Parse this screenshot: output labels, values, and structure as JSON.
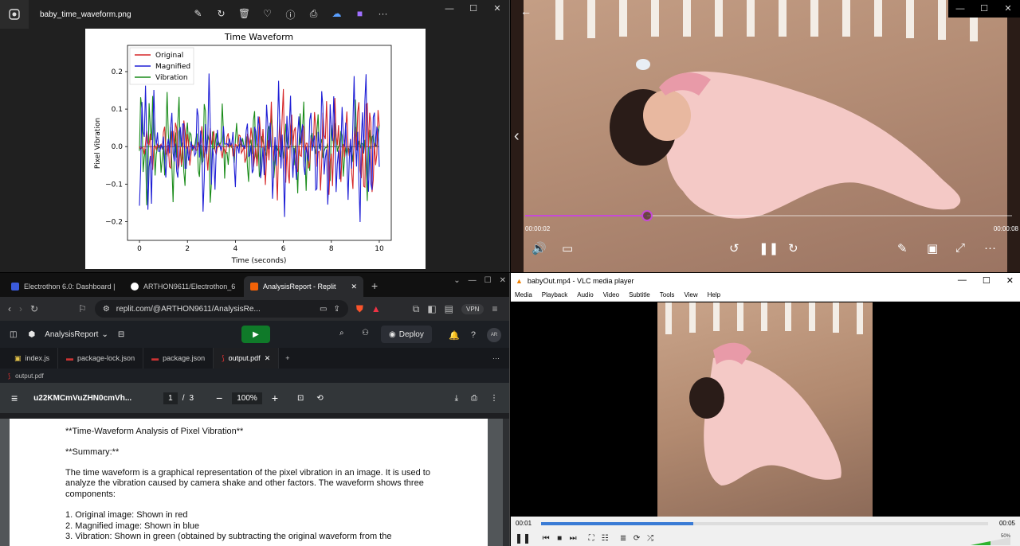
{
  "photos": {
    "filename": "baby_time_waveform.png",
    "toolbar_icons": [
      "edit-icon",
      "rotate-icon",
      "delete-icon",
      "heart-icon",
      "info-icon",
      "print-icon",
      "cloud-off-icon",
      "clipchamp-icon",
      "more-icon"
    ]
  },
  "chart_data": {
    "type": "line",
    "title": "Time Waveform",
    "xlabel": "Time (seconds)",
    "ylabel": "Pixel Vibration",
    "xlim": [
      -0.5,
      10.5
    ],
    "ylim": [
      -0.25,
      0.27
    ],
    "xticks": [
      0,
      2,
      4,
      6,
      8,
      10
    ],
    "yticks": [
      -0.2,
      -0.1,
      0.0,
      0.1,
      0.2
    ],
    "ytick_labels": [
      "−0.2",
      "−0.1",
      "0.0",
      "0.1",
      "0.2"
    ],
    "legend": "top-left",
    "series": [
      {
        "name": "Original",
        "color": "#d62728",
        "x": [
          0,
          0.5,
          1,
          1.5,
          2,
          2.5,
          3,
          3.5,
          4,
          4.5,
          5,
          5.5,
          6,
          6.5,
          7,
          7.5,
          8,
          8.5,
          9,
          9.5,
          10
        ],
        "y": [
          0.0,
          -0.08,
          0.06,
          0.1,
          0.08,
          -0.05,
          -0.08,
          0.05,
          0.03,
          0.06,
          0.09,
          0.12,
          0.18,
          0.1,
          0.06,
          0.13,
          0.17,
          0.08,
          0.14,
          0.2,
          0.1
        ]
      },
      {
        "name": "Magnified",
        "color": "#1f1fd6",
        "x": [
          0,
          0.5,
          1,
          1.5,
          2,
          2.5,
          3,
          3.5,
          4,
          4.5,
          5,
          5.5,
          6,
          6.5,
          7,
          7.5,
          8,
          8.5,
          9,
          9.5,
          10
        ],
        "y": [
          -0.18,
          -0.23,
          0.08,
          0.11,
          0.1,
          -0.17,
          -0.21,
          0.07,
          -0.12,
          0.08,
          0.12,
          0.14,
          0.2,
          0.12,
          0.09,
          0.17,
          0.19,
          0.11,
          0.2,
          0.24,
          0.08
        ]
      },
      {
        "name": "Vibration",
        "color": "#1a8c1a",
        "x": [
          0,
          0.5,
          1,
          1.5,
          2,
          2.5,
          3,
          3.5,
          4,
          4.5,
          5,
          5.5,
          6,
          6.5,
          7,
          7.5,
          8,
          8.5,
          9,
          9.5,
          10
        ],
        "y": [
          -0.15,
          -0.21,
          0.15,
          0.15,
          0.12,
          -0.12,
          -0.17,
          0.16,
          -0.09,
          0.1,
          0.12,
          -0.16,
          0.11,
          -0.13,
          -0.16,
          0.13,
          -0.16,
          0.11,
          -0.13,
          0.15,
          -0.08
        ]
      }
    ]
  },
  "video": {
    "time_current": "00:00:02",
    "time_total": "00:00:08",
    "progress": 0.25
  },
  "browser": {
    "tabs": [
      {
        "label": "Electrothon 6.0: Dashboard |",
        "color": "#3b5bdb"
      },
      {
        "label": "ARTHON9611/Electrothon_6",
        "color": "#ffffff"
      },
      {
        "label": "AnalysisReport - Replit",
        "color": "#f26207"
      }
    ],
    "url": "replit.com/@ARTHON9611/AnalysisRe...",
    "vpn_label": "VPN",
    "shield_count": "8",
    "repl_name": "AnalysisReport",
    "deploy_label": "Deploy",
    "avatar_initials": "AR",
    "file_tabs": [
      "index.js",
      "package-lock.json",
      "package.json",
      "output.pdf"
    ],
    "breadcrumb": "output.pdf",
    "pdf": {
      "doc_title": "u22KMCmVuZHN0cmVh...",
      "page_current": "1",
      "page_total": "3",
      "zoom": "100%",
      "lines": [
        "**Time-Waveform Analysis of Pixel Vibration**",
        "**Summary:**",
        "The time waveform is a graphical representation of the pixel vibration in an image. It is used to analyze the vibration caused by camera shake and other factors. The waveform shows three components:",
        "1. Original image: Shown in red",
        "2. Magnified image: Shown in blue",
        "3. Vibration: Shown in green (obtained by subtracting the original waveform from the"
      ]
    }
  },
  "vlc": {
    "title": "babyOut.mp4 - VLC media player",
    "menu": [
      "Media",
      "Playback",
      "Audio",
      "Video",
      "Subtitle",
      "Tools",
      "View",
      "Help"
    ],
    "time_current": "00:01",
    "time_total": "00:05",
    "progress": 0.34,
    "volume": "50%"
  }
}
